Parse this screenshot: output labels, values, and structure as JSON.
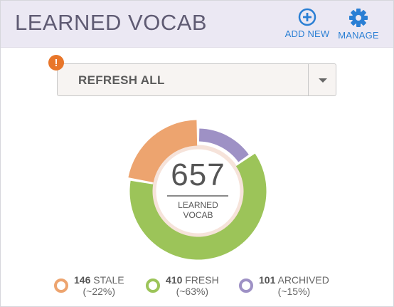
{
  "header": {
    "title": "LEARNED VOCAB",
    "add_new_label": "ADD NEW",
    "manage_label": "MANAGE"
  },
  "filter": {
    "selected": "REFRESH ALL",
    "warning_glyph": "!"
  },
  "summary": {
    "total": "657",
    "label_line1": "LEARNED",
    "label_line2": "VOCAB"
  },
  "legend": [
    {
      "count": "146",
      "name": "STALE",
      "pct": "(~22%)"
    },
    {
      "count": "410",
      "name": "FRESH",
      "pct": "(~63%)"
    },
    {
      "count": "101",
      "name": "ARCHIVED",
      "pct": "(~15%)"
    }
  ],
  "colors": {
    "accent": "#2a7fd4",
    "warning": "#e8762a",
    "stale": "#eda46f",
    "fresh": "#9cc459",
    "archived": "#9e91c5"
  },
  "icons": {
    "add": "plus-circle-icon",
    "manage": "gear-icon",
    "warning": "exclamation-icon",
    "dropdown": "caret-down-icon"
  },
  "chart_data": {
    "type": "pie",
    "categories": [
      "STALE",
      "FRESH",
      "ARCHIVED"
    ],
    "values": [
      146,
      410,
      101
    ],
    "title": "",
    "legend": "bottom"
  }
}
